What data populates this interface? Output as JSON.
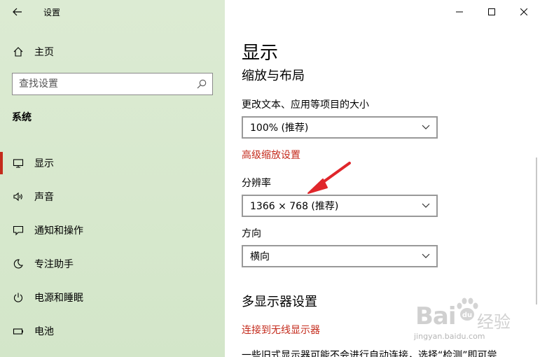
{
  "window": {
    "title": "设置",
    "controls": [
      "minimize",
      "maximize",
      "close"
    ]
  },
  "sidebar": {
    "home_label": "主页",
    "search_placeholder": "查找设置",
    "section_title": "系统",
    "items": [
      {
        "label": "显示",
        "icon": "monitor-icon",
        "selected": true
      },
      {
        "label": "声音",
        "icon": "speaker-icon",
        "selected": false
      },
      {
        "label": "通知和操作",
        "icon": "notification-icon",
        "selected": false
      },
      {
        "label": "专注助手",
        "icon": "moon-icon",
        "selected": false
      },
      {
        "label": "电源和睡眠",
        "icon": "power-icon",
        "selected": false
      },
      {
        "label": "电池",
        "icon": "battery-icon",
        "selected": false
      }
    ]
  },
  "content": {
    "page_title": "显示",
    "scale_layout_heading": "缩放与布局",
    "scale_label": "更改文本、应用等项目的大小",
    "scale_value": "100% (推荐)",
    "advanced_scaling_link": "高级缩放设置",
    "resolution_label": "分辨率",
    "resolution_value": "1366 × 768 (推荐)",
    "orientation_label": "方向",
    "orientation_value": "横向",
    "multi_display_heading": "多显示器设置",
    "wireless_link": "连接到无线显示器",
    "bottom_text": "一些旧式显示器可能不会进行自动连接，选择“检测”即可尝"
  },
  "watermark": {
    "main": "Bai",
    "paw_letters": "du",
    "cn": "经验",
    "sub": "jingyan.baidu.com"
  },
  "colors": {
    "accent_red": "#c42b1c",
    "annotation_arrow": "#e0262b",
    "sidebar_bg": "#d7e8cd"
  }
}
